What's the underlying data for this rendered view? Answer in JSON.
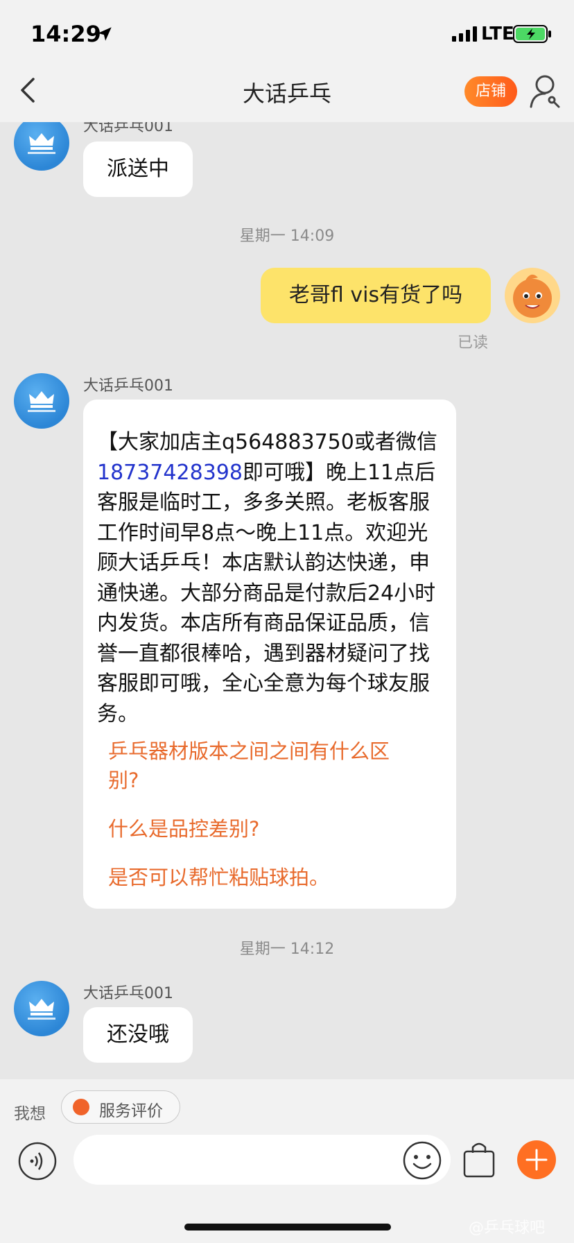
{
  "status_bar": {
    "time": "14:29",
    "network": "LTE"
  },
  "nav": {
    "title": "大话乒乓",
    "shop_button": "店铺"
  },
  "messages": [
    {
      "sender": "大话乒乓001",
      "text": "派送中"
    },
    {
      "timestamp": "星期一 14:09"
    },
    {
      "mine": "老哥fl vis有货了吗",
      "status": "已读"
    },
    {
      "sender": "大话乒乓001",
      "text_before_phone": "【大家加店主q564883750或者微信",
      "phone": "18737428398",
      "text_after_phone": "即可哦】晚上11点后客服是临时工，多多关照。老板客服工作时间早8点～晚上11点。欢迎光顾大话乒乓！本店默认韵达快递，申通快递。大部分商品是付款后24小时内发货。本店所有商品保证品质，信誉一直都很棒哈，遇到器材疑问了找客服即可哦，全心全意为每个球友服务。",
      "faq": [
        "乒乓器材版本之间之间有什么区别?",
        "什么是品控差别?",
        "是否可以帮忙粘贴球拍。"
      ]
    },
    {
      "timestamp": "星期一 14:12"
    },
    {
      "sender": "大话乒乓001",
      "text": "还没哦"
    }
  ],
  "bottom": {
    "prompt": "我想",
    "service_chip": "服务评价",
    "input_placeholder": ""
  },
  "watermark": "@乒乓球吧",
  "colors": {
    "accent": "#ff6b1a",
    "my_bubble": "#fde36a",
    "faq_link": "#e86a2c",
    "phone_link": "#2233cc"
  }
}
